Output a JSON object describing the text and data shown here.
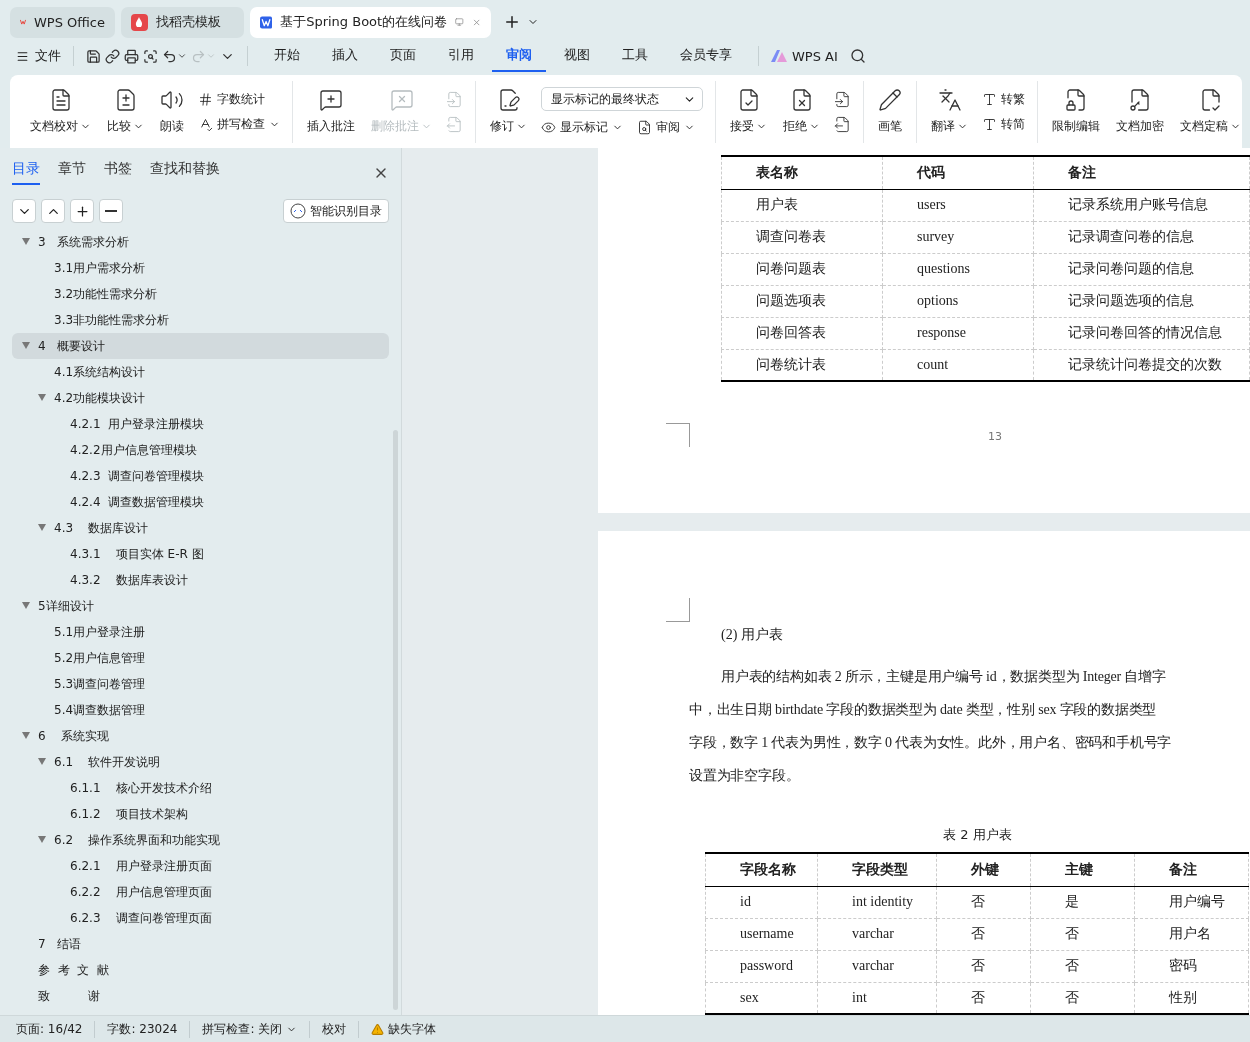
{
  "title_bar": {
    "tabs": [
      {
        "label": "WPS Office",
        "kind": "home",
        "selected": false
      },
      {
        "label": "找稻壳模板",
        "kind": "template",
        "selected": false
      },
      {
        "label": "基于Spring Boot的在线问卷",
        "kind": "doc",
        "selected": true
      }
    ]
  },
  "menu": {
    "file": "文件",
    "tabs": [
      {
        "label": "开始",
        "selected": false
      },
      {
        "label": "插入",
        "selected": false
      },
      {
        "label": "页面",
        "selected": false
      },
      {
        "label": "引用",
        "selected": false
      },
      {
        "label": "审阅",
        "selected": true
      },
      {
        "label": "视图",
        "selected": false
      },
      {
        "label": "工具",
        "selected": false
      },
      {
        "label": "会员专享",
        "selected": false
      }
    ],
    "ai": "WPS AI"
  },
  "ribbon": {
    "groups": [
      {
        "items": [
          {
            "kind": "large",
            "label": "文档校对",
            "has_dropdown": true,
            "disabled": false
          },
          {
            "kind": "large",
            "label": "比较",
            "has_dropdown": true,
            "disabled": false
          },
          {
            "kind": "large",
            "label": "朗读",
            "has_dropdown": false,
            "disabled": false
          },
          {
            "kind": "stack",
            "items": [
              {
                "label": "字数统计",
                "has_dropdown": false
              },
              {
                "label": "拼写检查",
                "has_dropdown": true
              }
            ]
          }
        ]
      },
      {
        "items": [
          {
            "kind": "large",
            "label": "插入批注",
            "has_dropdown": false,
            "disabled": false
          },
          {
            "kind": "large",
            "label": "删除批注",
            "has_dropdown": true,
            "disabled": true
          },
          {
            "kind": "icons",
            "disabled": true
          }
        ]
      },
      {
        "items": [
          {
            "kind": "large",
            "label": "修订",
            "has_dropdown": true,
            "disabled": false
          },
          {
            "kind": "select-stack",
            "value": "显示标记的最终状态",
            "items": [
              {
                "label": "显示标记",
                "has_dropdown": true
              },
              {
                "label": "审阅",
                "has_dropdown": true
              }
            ]
          }
        ]
      },
      {
        "items": [
          {
            "kind": "large",
            "label": "接受",
            "has_dropdown": true,
            "disabled": false
          },
          {
            "kind": "large",
            "label": "拒绝",
            "has_dropdown": true,
            "disabled": false
          },
          {
            "kind": "icons",
            "disabled": false
          }
        ]
      },
      {
        "items": [
          {
            "kind": "large",
            "label": "画笔",
            "has_dropdown": false,
            "disabled": false
          }
        ]
      },
      {
        "items": [
          {
            "kind": "large",
            "label": "翻译",
            "has_dropdown": true,
            "disabled": false
          },
          {
            "kind": "stack",
            "items": [
              {
                "label": "转繁",
                "has_dropdown": false
              },
              {
                "label": "转简",
                "has_dropdown": false
              }
            ]
          }
        ]
      },
      {
        "items": [
          {
            "kind": "large",
            "label": "限制编辑",
            "has_dropdown": false,
            "disabled": false
          },
          {
            "kind": "large",
            "label": "文档加密",
            "has_dropdown": false,
            "disabled": false
          },
          {
            "kind": "large",
            "label": "文档定稿",
            "has_dropdown": true,
            "disabled": false
          }
        ]
      }
    ]
  },
  "sidebar": {
    "tabs": [
      {
        "label": "目录",
        "selected": true
      },
      {
        "label": "章节",
        "selected": false
      },
      {
        "label": "书签",
        "selected": false
      },
      {
        "label": "查找和替换",
        "selected": false
      }
    ],
    "smart_button": "智能识别目录",
    "outline": [
      {
        "label": "3   系统需求分析",
        "selected": false,
        "expanded": true,
        "children": [
          {
            "label": "3.1用户需求分析",
            "selected": false
          },
          {
            "label": "3.2功能性需求分析",
            "selected": false
          },
          {
            "label": "3.3非功能性需求分析",
            "selected": false
          }
        ]
      },
      {
        "label": "4   概要设计",
        "selected": true,
        "expanded": true,
        "children": [
          {
            "label": "4.1系统结构设计",
            "selected": false
          },
          {
            "label": "4.2功能模块设计",
            "selected": false,
            "expanded": true,
            "children": [
              {
                "label": "4.2.1  用户登录注册模块",
                "selected": false
              },
              {
                "label": "4.2.2用户信息管理模块",
                "selected": false
              },
              {
                "label": "4.2.3  调查问卷管理模块",
                "selected": false
              },
              {
                "label": "4.2.4  调查数据管理模块",
                "selected": false
              }
            ]
          },
          {
            "label": "4.3    数据库设计",
            "selected": false,
            "expanded": true,
            "children": [
              {
                "label": "4.3.1    项目实体 E-R 图",
                "selected": false
              },
              {
                "label": "4.3.2    数据库表设计",
                "selected": false
              }
            ]
          }
        ]
      },
      {
        "label": "5详细设计",
        "selected": false,
        "expanded": true,
        "children": [
          {
            "label": "5.1用户登录注册",
            "selected": false
          },
          {
            "label": "5.2用户信息管理",
            "selected": false
          },
          {
            "label": "5.3调查问卷管理",
            "selected": false
          },
          {
            "label": "5.4调查数据管理",
            "selected": false
          }
        ]
      },
      {
        "label": "6    系统实现",
        "selected": false,
        "expanded": true,
        "children": [
          {
            "label": "6.1    软件开发说明",
            "selected": false,
            "expanded": true,
            "children": [
              {
                "label": "6.1.1    核心开发技术介绍",
                "selected": false
              },
              {
                "label": "6.1.2    项目技术架构",
                "selected": false
              }
            ]
          },
          {
            "label": "6.2    操作系统界面和功能实现",
            "selected": false,
            "expanded": true,
            "children": [
              {
                "label": "6.2.1    用户登录注册页面",
                "selected": false
              },
              {
                "label": "6.2.2    用户信息管理页面",
                "selected": false
              },
              {
                "label": "6.2.3    调查问卷管理页面",
                "selected": false
              }
            ]
          }
        ]
      },
      {
        "label": "7   结语",
        "selected": false
      },
      {
        "label": "参  考  文  献",
        "selected": false
      },
      {
        "label": "致          谢",
        "selected": false
      }
    ]
  },
  "document": {
    "page_1": {
      "table": {
        "columns": [
          "表名称",
          "代码",
          "备注"
        ],
        "rows": [
          [
            "用户表",
            "users",
            "记录系统用户账号信息"
          ],
          [
            "调查问卷表",
            "survey",
            "记录调查问卷的信息"
          ],
          [
            "问卷问题表",
            "questions",
            "记录问卷问题的信息"
          ],
          [
            "问题选项表",
            "options",
            "记录问题选项的信息"
          ],
          [
            "问卷回答表",
            "response",
            "记录问卷回答的情况信息"
          ],
          [
            "问卷统计表",
            "count",
            "记录统计问卷提交的次数"
          ]
        ]
      },
      "page_number": "13"
    },
    "page_2": {
      "heading": "(2)  用户表",
      "paragraph_lines": [
        "用户表的结构如表 2 所示，主键是用户编号 id，数据类型为 Integer  自增字",
        "中，出生日期 birthdate 字段的数据类型为 date 类型，性别 sex 字段的数据类型",
        "字段，数字 1 代表为男性，数字 0 代表为女性。此外，用户名、密码和手机号字",
        "设置为非空字段。"
      ],
      "caption": "表 2  用户表",
      "table": {
        "columns": [
          "字段名称",
          "字段类型",
          "外键",
          "主键",
          "备注"
        ],
        "rows": [
          [
            "id",
            "int identity",
            "否",
            "是",
            "用户编号"
          ],
          [
            "username",
            "varchar",
            "否",
            "否",
            "用户名"
          ],
          [
            "password",
            "varchar",
            "否",
            "否",
            "密码"
          ],
          [
            "sex",
            "int",
            "否",
            "否",
            "性别"
          ]
        ]
      }
    }
  },
  "status_bar": {
    "items": [
      {
        "label": "页面: 16/42",
        "kind": "plain",
        "has_dropdown": false
      },
      {
        "label": "字数: 23024",
        "kind": "plain",
        "has_dropdown": false
      },
      {
        "label": "拼写检查: 关闭",
        "kind": "plain",
        "has_dropdown": true
      },
      {
        "label": "校对",
        "kind": "plain",
        "has_dropdown": false
      },
      {
        "label": "缺失字体",
        "kind": "warning",
        "has_dropdown": false
      }
    ]
  }
}
